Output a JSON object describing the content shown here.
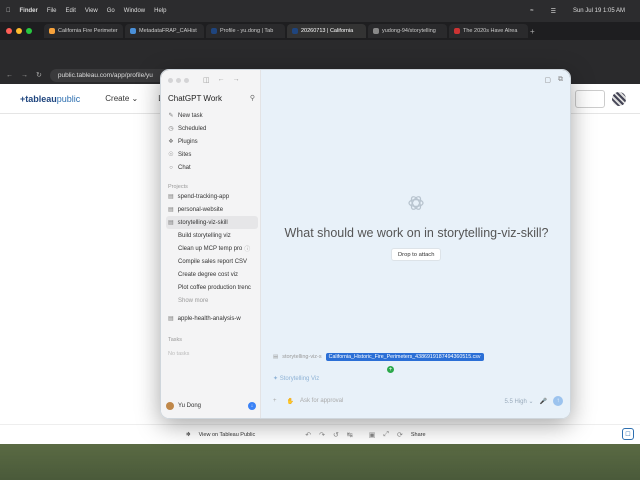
{
  "menubar": {
    "items": [
      "Finder",
      "File",
      "Edit",
      "View",
      "Go",
      "Window",
      "Help"
    ],
    "clock": "Sun Jul 19  1:05 AM"
  },
  "browser": {
    "tabs": [
      {
        "label": "California Fire Perimeter"
      },
      {
        "label": "MetadataFRAP_CAHist"
      },
      {
        "label": "Profile - yu.dong | Tab"
      },
      {
        "label": "20260713 | California"
      },
      {
        "label": "yudong-94/storytelling"
      },
      {
        "label": "The 2020s Have Alrea"
      }
    ],
    "url": "public.tableau.com/app/profile/yu"
  },
  "tableau": {
    "logo_main": "+tableau",
    "logo_sub": "public",
    "create_label": "Create",
    "truncated_nav": "Le",
    "footer": {
      "view_label": "View on Tableau Public",
      "share_label": "Share"
    }
  },
  "chatgpt": {
    "title": "ChatGPT Work",
    "nav": [
      {
        "label": "New task",
        "icon": "compose-icon"
      },
      {
        "label": "Scheduled",
        "icon": "clock-icon"
      },
      {
        "label": "Plugins",
        "icon": "plugin-icon"
      },
      {
        "label": "Sites",
        "icon": "globe-icon"
      },
      {
        "label": "Chat",
        "icon": "chat-icon"
      }
    ],
    "projects_label": "Projects",
    "projects": [
      {
        "label": "spend-tracking-app"
      },
      {
        "label": "personal-website"
      },
      {
        "label": "storytelling-viz-skill"
      }
    ],
    "project_tasks": [
      {
        "label": "Build storytelling viz"
      },
      {
        "label": "Clean up MCP temp pro"
      },
      {
        "label": "Compile sales report CSV"
      },
      {
        "label": "Create degree cost viz"
      },
      {
        "label": "Plot coffee production trenc"
      }
    ],
    "show_more": "Show more",
    "other_project": "apple-health-analysis-w",
    "tasks_label": "Tasks",
    "no_tasks": "No tasks",
    "user_name": "Yu Dong",
    "headline": "What should we work on in storytelling-viz-skill?",
    "drop_label": "Drop to attach",
    "attach_folder": "storytelling-viz-s",
    "dragged_file": "California_Historic_Fire_Perimeters_4386919187494360515.csv",
    "workspace_label": "Storytelling Viz",
    "input_placeholder": "Ask for approval",
    "model_label": "5.5 High"
  }
}
